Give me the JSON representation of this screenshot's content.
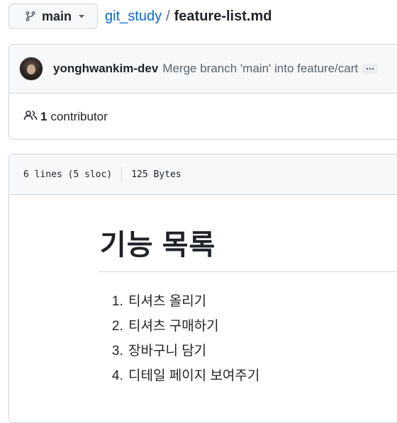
{
  "breadcrumb": {
    "branch": "main",
    "repo": "git_study",
    "separator": "/",
    "file": "feature-list.md"
  },
  "commit": {
    "author": "yonghwankim-dev",
    "message": "Merge branch 'main' into feature/cart",
    "more": "…"
  },
  "contributors": {
    "count": "1",
    "label": "contributor"
  },
  "file_info": {
    "lines": "6 lines (5 sloc)",
    "size": "125 Bytes"
  },
  "markdown": {
    "title": "기능 목록",
    "items": [
      "티셔츠 올리기",
      "티셔츠 구매하기",
      "장바구니 담기",
      "디테일 페이지 보여주기"
    ]
  },
  "colors": {
    "link": "#0969da",
    "text": "#1f2328",
    "muted": "#59636e",
    "border": "#d0d7de",
    "header_bg": "#f6f8fa"
  },
  "icons": [
    "git-branch-icon",
    "caret-down-icon",
    "people-icon"
  ]
}
